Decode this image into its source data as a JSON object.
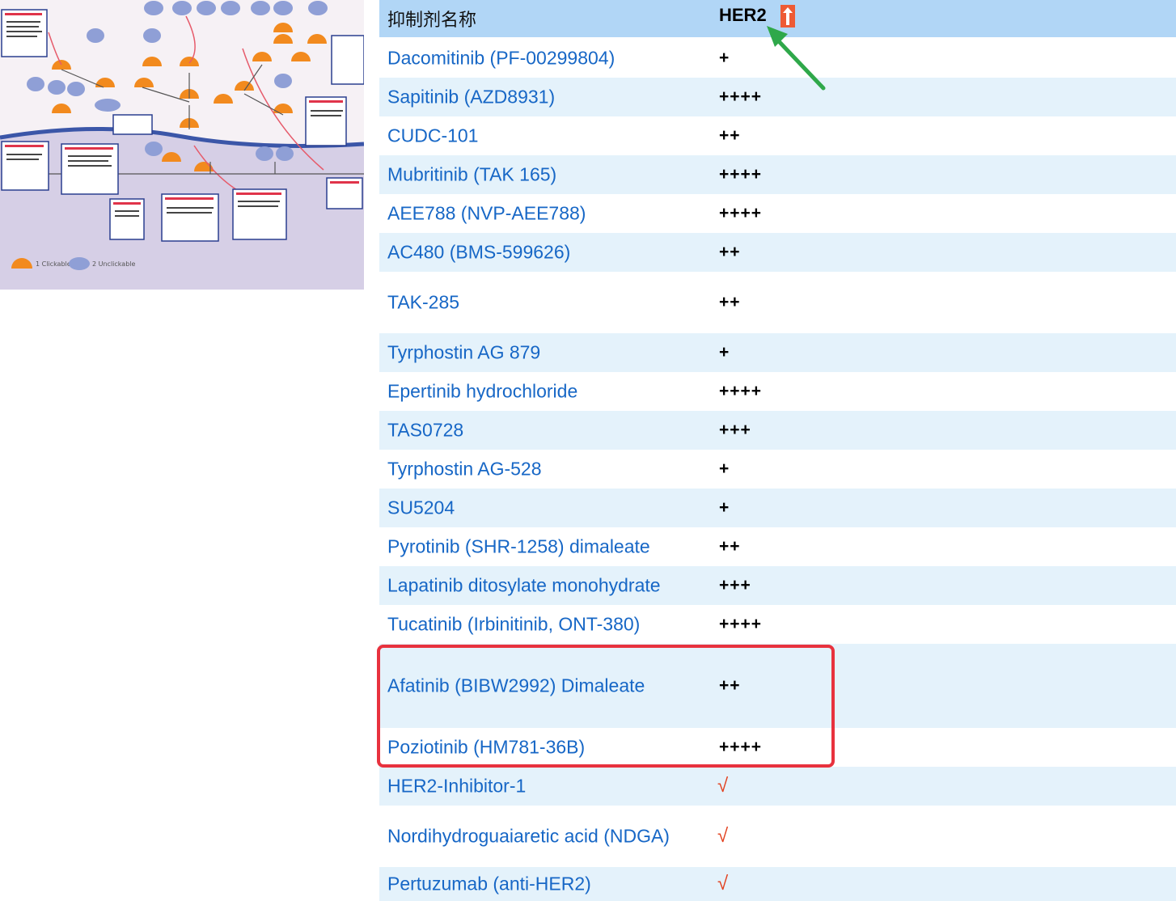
{
  "thumbnail": {
    "legend_clickable": "1 Clickable",
    "legend_unclickable": "2 Unclickable",
    "colors": {
      "node": "#f28a1e",
      "node_blue": "#9aa6d8",
      "membrane": "#3b56a8",
      "nucleus": "#d9d3e8"
    }
  },
  "table": {
    "header": {
      "name": "抑制剂名称",
      "target": "HER2",
      "target_icon": "up-arrow-icon"
    },
    "rows": [
      {
        "name": "Dacomitinib (PF-00299804)",
        "value": "+"
      },
      {
        "name": "Sapitinib (AZD8931)",
        "value": "++++"
      },
      {
        "name": "CUDC-101",
        "value": "++"
      },
      {
        "name": "Mubritinib (TAK 165)",
        "value": "++++"
      },
      {
        "name": "AEE788 (NVP-AEE788)",
        "value": "++++"
      },
      {
        "name": "AC480 (BMS-599626)",
        "value": "++"
      },
      {
        "name": "TAK-285",
        "value": "++"
      },
      {
        "name": "Tyrphostin AG 879",
        "value": "+"
      },
      {
        "name": "Epertinib hydrochloride",
        "value": "++++"
      },
      {
        "name": "TAS0728",
        "value": "+++"
      },
      {
        "name": "Tyrphostin AG-528",
        "value": "+"
      },
      {
        "name": "SU5204",
        "value": "+"
      },
      {
        "name": "Pyrotinib (SHR-1258) dimaleate",
        "value": "++"
      },
      {
        "name": "Lapatinib ditosylate monohydrate",
        "value": "+++"
      },
      {
        "name": "Tucatinib (Irbinitinib, ONT-380)",
        "value": "++++"
      },
      {
        "name": "Afatinib (BIBW2992) Dimaleate",
        "value": "++"
      },
      {
        "name": "Poziotinib (HM781-36B)",
        "value": "++++"
      },
      {
        "name": "HER2-Inhibitor-1",
        "value": "√"
      },
      {
        "name": "Nordihydroguaiaretic acid (NDGA)",
        "value": "√"
      },
      {
        "name": "Pertuzumab (anti-HER2)",
        "value": "√"
      }
    ],
    "colors": {
      "header_bg": "#b1d6f6",
      "stripe": "#e4f2fb",
      "link": "#1767c6",
      "check": "#e2401e",
      "highlight": "#e8323e",
      "pointer": "#2fa84a"
    }
  }
}
